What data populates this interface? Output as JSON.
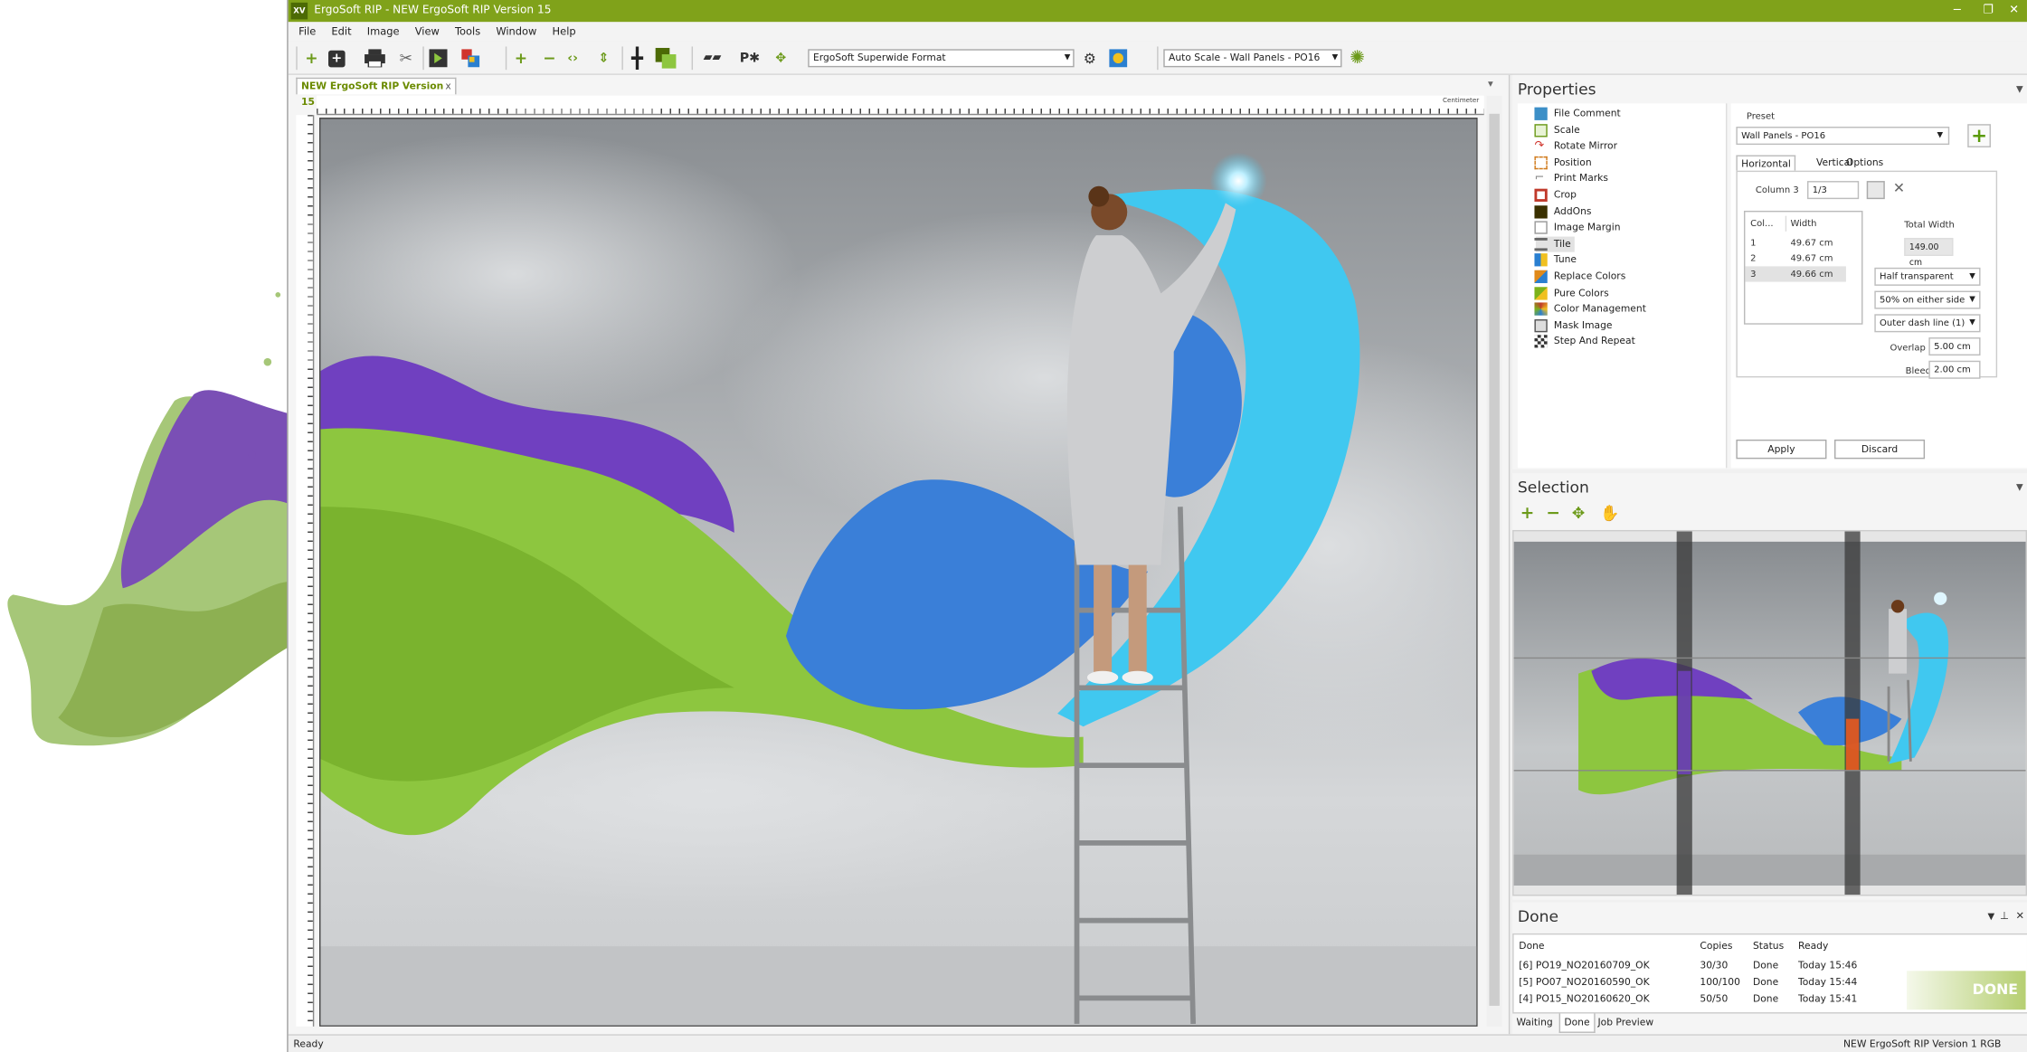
{
  "window": {
    "title": "ErgoSoft RIP - NEW ErgoSoft RIP Version 15",
    "logo_text": "XV",
    "minimize": "−",
    "maximize": "❐",
    "close": "✕"
  },
  "menu": [
    "File",
    "Edit",
    "Image",
    "View",
    "Tools",
    "Window",
    "Help"
  ],
  "toolbar": {
    "format_combo": "ErgoSoft Superwide Format",
    "scale_combo": "Auto Scale - Wall Panels - PO16"
  },
  "document": {
    "tab_label": "NEW ErgoSoft RIP Version 15",
    "tab_close": "x",
    "ruler_unit": "Centimeter"
  },
  "status": {
    "left": "Ready",
    "right": "NEW ErgoSoft RIP Version 1  RGB"
  },
  "properties": {
    "title": "Properties",
    "tree": [
      {
        "label": "File Comment",
        "icon": "comment-icon",
        "color": "#3c8fc7"
      },
      {
        "label": "Scale",
        "icon": "scale-icon",
        "color": "#6c9a1a"
      },
      {
        "label": "Rotate Mirror",
        "icon": "rotate-icon",
        "color": "#d0342c"
      },
      {
        "label": "Position",
        "icon": "position-icon",
        "color": "#d07a1a"
      },
      {
        "label": "Print Marks",
        "icon": "printmarks-icon",
        "color": "#888888"
      },
      {
        "label": "Crop",
        "icon": "crop-icon",
        "color": "#c0392b"
      },
      {
        "label": "AddOns",
        "icon": "addons-icon",
        "color": "#7a5a00"
      },
      {
        "label": "Image Margin",
        "icon": "margin-icon",
        "color": "#999999"
      },
      {
        "label": "Tile",
        "icon": "tile-icon",
        "color": "#666666"
      },
      {
        "label": "Tune",
        "icon": "tune-icon",
        "color": "#2a7fd0"
      },
      {
        "label": "Replace Colors",
        "icon": "replace-colors-icon",
        "color": "#e08a1a"
      },
      {
        "label": "Pure Colors",
        "icon": "pure-colors-icon",
        "color": "#7cb21a"
      },
      {
        "label": "Color Management",
        "icon": "color-management-icon",
        "color": "#c0392b"
      },
      {
        "label": "Mask Image",
        "icon": "mask-icon",
        "color": "#555555"
      },
      {
        "label": "Step And Repeat",
        "icon": "step-repeat-icon",
        "color": "#333333"
      }
    ],
    "preset_label": "Preset",
    "preset_value": "Wall Panels - PO16",
    "tabs": [
      "Horizontal",
      "Vertical",
      "Options"
    ],
    "column_label": "Column 3",
    "column_value": "1/3",
    "col_header": "Col...",
    "width_header": "Width",
    "rows": [
      {
        "col": "1",
        "width": "49.67 cm"
      },
      {
        "col": "2",
        "width": "49.67 cm"
      },
      {
        "col": "3",
        "width": "49.66 cm"
      }
    ],
    "total_width_label": "Total Width",
    "total_width_value": "149.00 cm",
    "dd1": "Half transparent",
    "dd2": "50% on either side",
    "dd3": "Outer dash line (1)",
    "overlap_label": "Overlap",
    "overlap_value": "5.00 cm",
    "bleed_label": "Bleed",
    "bleed_value": "2.00 cm",
    "apply": "Apply",
    "discard": "Discard"
  },
  "selection": {
    "title": "Selection"
  },
  "done": {
    "title": "Done",
    "headers": [
      "Done",
      "Copies",
      "Status",
      "Ready"
    ],
    "jobs": [
      {
        "name": "[6]  PO19_NO20160709_OK",
        "copies": "30/30",
        "status": "Done",
        "ready": "Today 15:46"
      },
      {
        "name": "[5]  PO07_NO20160590_OK",
        "copies": "100/100",
        "status": "Done",
        "ready": "Today 15:44"
      },
      {
        "name": "[4]  PO15_NO20160620_OK",
        "copies": "50/50",
        "status": "Done",
        "ready": "Today 15:41"
      }
    ],
    "badge": "DONE",
    "tabs": [
      "Waiting",
      "Done",
      "Job Preview"
    ]
  },
  "colors": {
    "accent": "#80a21a",
    "green_paint": "#8dc63f",
    "purple_paint": "#7040c0",
    "blue_paint": "#3a7fd8",
    "cyan_paint": "#40c8f0"
  }
}
